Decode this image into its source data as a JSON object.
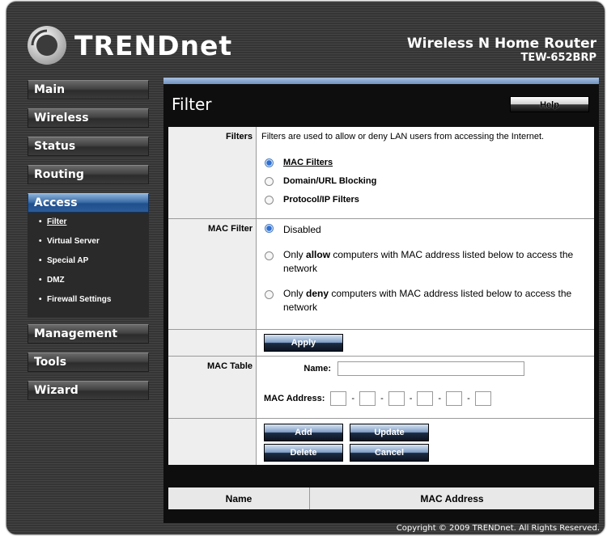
{
  "brand": {
    "logo_text": "TRENDnet"
  },
  "product": {
    "name": "Wireless N Home Router",
    "model": "TEW-652BRP"
  },
  "nav": {
    "items": [
      {
        "label": "Main"
      },
      {
        "label": "Wireless"
      },
      {
        "label": "Status"
      },
      {
        "label": "Routing"
      },
      {
        "label": "Access"
      },
      {
        "label": "Management"
      },
      {
        "label": "Tools"
      },
      {
        "label": "Wizard"
      }
    ],
    "access_sub": [
      {
        "label": "Filter"
      },
      {
        "label": "Virtual Server"
      },
      {
        "label": "Special AP"
      },
      {
        "label": "DMZ"
      },
      {
        "label": "Firewall Settings"
      }
    ]
  },
  "panel": {
    "title": "Filter",
    "help_label": "Help"
  },
  "filters": {
    "label": "Filters",
    "description": "Filters are used to allow or deny LAN users from accessing the Internet.",
    "options": [
      "MAC Filters",
      "Domain/URL Blocking",
      "Protocol/IP Filters"
    ],
    "selected": "MAC Filters"
  },
  "mac_filter": {
    "label": "MAC Filter",
    "disabled_label": "Disabled",
    "allow_prefix": "Only ",
    "allow_word": "allow",
    "allow_suffix": " computers with MAC address listed below to access the network",
    "deny_prefix": "Only ",
    "deny_word": "deny",
    "deny_suffix": " computers with MAC address listed below to access the network",
    "selected": "Disabled"
  },
  "apply_label": "Apply",
  "mac_table": {
    "label": "MAC Table",
    "name_label": "Name:",
    "name_value": "",
    "mac_label": "MAC Address:",
    "mac_values": [
      "",
      "",
      "",
      "",
      "",
      ""
    ],
    "separator": "-"
  },
  "buttons": {
    "add": "Add",
    "update": "Update",
    "delete": "Delete",
    "cancel": "Cancel"
  },
  "list": {
    "columns": [
      "Name",
      "MAC Address"
    ]
  },
  "footer": {
    "copyright": "Copyright © 2009 TRENDnet. All Rights Reserved."
  },
  "colors": {
    "accent": "#2c5c99",
    "radio_selected": "#2e6fd3"
  }
}
